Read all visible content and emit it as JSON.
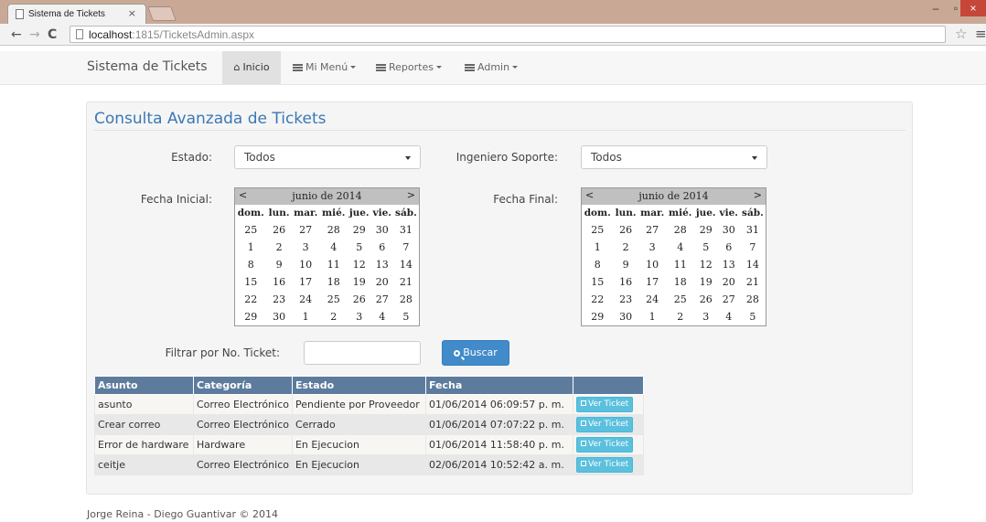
{
  "browser": {
    "tab_title": "Sistema de Tickets",
    "tab_close": "×",
    "url_host": "localhost",
    "url_path": ":1815/TicketsAdmin.aspx"
  },
  "navbar": {
    "brand": "Sistema de Tickets",
    "items": [
      {
        "label": "Inicio",
        "icon": "home-icon",
        "active": true
      },
      {
        "label": "Mi Menú",
        "icon": "list-icon"
      },
      {
        "label": "Reportes",
        "icon": "list-icon"
      },
      {
        "label": "Admin",
        "icon": "list-icon"
      }
    ]
  },
  "page": {
    "title": "Consulta Avanzada de Tickets"
  },
  "filters": {
    "estado_label": "Estado:",
    "estado_value": "Todos",
    "ingeniero_label": "Ingeniero Soporte:",
    "ingeniero_value": "Todos",
    "fecha_inicial_label": "Fecha Inicial:",
    "fecha_final_label": "Fecha Final:",
    "ticket_label": "Filtrar por No. Ticket:",
    "ticket_value": "",
    "buscar_label": "Buscar"
  },
  "calendars": [
    {
      "prev": "<",
      "next": ">",
      "month": "junio de 2014",
      "days": [
        "dom.",
        "lun.",
        "mar.",
        "mié.",
        "jue.",
        "vie.",
        "sáb."
      ],
      "weeks": [
        [
          "25",
          "26",
          "27",
          "28",
          "29",
          "30",
          "31"
        ],
        [
          "1",
          "2",
          "3",
          "4",
          "5",
          "6",
          "7"
        ],
        [
          "8",
          "9",
          "10",
          "11",
          "12",
          "13",
          "14"
        ],
        [
          "15",
          "16",
          "17",
          "18",
          "19",
          "20",
          "21"
        ],
        [
          "22",
          "23",
          "24",
          "25",
          "26",
          "27",
          "28"
        ],
        [
          "29",
          "30",
          "1",
          "2",
          "3",
          "4",
          "5"
        ]
      ]
    },
    {
      "prev": "<",
      "next": ">",
      "month": "junio de 2014",
      "days": [
        "dom.",
        "lun.",
        "mar.",
        "mié.",
        "jue.",
        "vie.",
        "sáb."
      ],
      "weeks": [
        [
          "25",
          "26",
          "27",
          "28",
          "29",
          "30",
          "31"
        ],
        [
          "1",
          "2",
          "3",
          "4",
          "5",
          "6",
          "7"
        ],
        [
          "8",
          "9",
          "10",
          "11",
          "12",
          "13",
          "14"
        ],
        [
          "15",
          "16",
          "17",
          "18",
          "19",
          "20",
          "21"
        ],
        [
          "22",
          "23",
          "24",
          "25",
          "26",
          "27",
          "28"
        ],
        [
          "29",
          "30",
          "1",
          "2",
          "3",
          "4",
          "5"
        ]
      ]
    }
  ],
  "grid": {
    "headers": [
      "Asunto",
      "Categoría",
      "Estado",
      "Fecha",
      ""
    ],
    "action_label": "Ver Ticket",
    "rows": [
      {
        "asunto": "asunto",
        "categoria": "Correo Electrónico",
        "estado": "Pendiente por Proveedor",
        "fecha": "01/06/2014 06:09:57 p. m."
      },
      {
        "asunto": "Crear correo",
        "categoria": "Correo Electrónico",
        "estado": "Cerrado",
        "fecha": "01/06/2014 07:07:22 p. m."
      },
      {
        "asunto": "Error de hardware",
        "categoria": "Hardware",
        "estado": "En Ejecucion",
        "fecha": "01/06/2014 11:58:40 p. m."
      },
      {
        "asunto": "ceitje",
        "categoria": "Correo Electrónico",
        "estado": "En Ejecucion",
        "fecha": "02/06/2014 10:52:42 a. m."
      }
    ]
  },
  "footer": {
    "text": "Jorge Reina - Diego Guantivar © 2014"
  },
  "colors": {
    "brand_blue": "#3a78b5",
    "button_primary": "#428bca",
    "button_info": "#5bc0de",
    "grid_header": "#5d7b9d"
  }
}
